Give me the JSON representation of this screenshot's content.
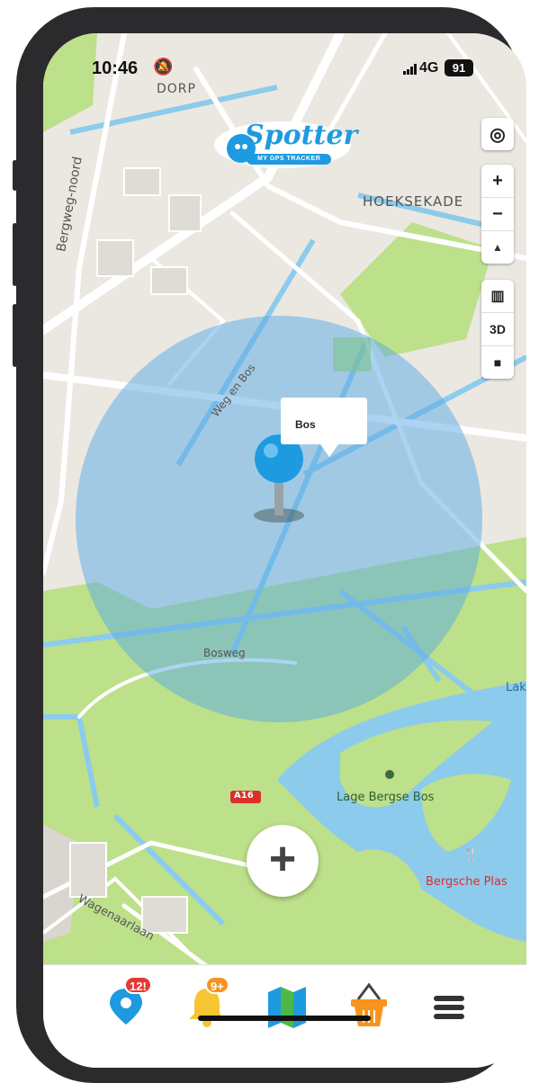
{
  "status_bar": {
    "time": "10:46",
    "network": "4G",
    "battery": "91"
  },
  "app": {
    "logo_text": "Spotter",
    "logo_tagline": "MY GPS TRACKER"
  },
  "map_controls": {
    "zoom_in": "+",
    "zoom_out": "−",
    "mode_3d": "3D"
  },
  "map_labels": {
    "dorp": "DORP",
    "bergweg_noord": "Bergweg-noord",
    "hoeksekade": "HOEKSEKADE",
    "weg_en_bos": "Weg en Bos",
    "bosweg": "Bosweg",
    "a16": "A16",
    "lage_bergse_bos": "Lage Bergse Bos",
    "bergsche_plas": "Bergsche Plas",
    "wagenaarlaan": "Wagenaarlaan",
    "lak": "Lak"
  },
  "geofence": {
    "name": "Bos"
  },
  "add_button": {
    "label": "+"
  },
  "tabs": {
    "trackers_badge": "12!",
    "alerts_badge": "9+"
  },
  "colors": {
    "geofence_fill": "#5aa9e6",
    "pin": "#1e9be0",
    "park": "#bde08a",
    "water": "#8ccbec",
    "badge_red": "#e53935",
    "badge_orange": "#f7931e"
  }
}
